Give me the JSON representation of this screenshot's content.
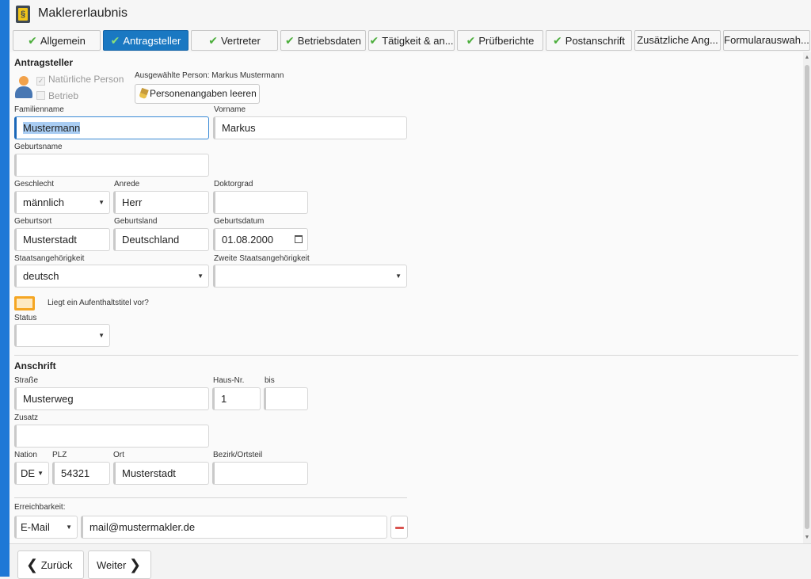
{
  "app": {
    "title": "Maklererlaubnis",
    "icon": "paragraph-book-icon"
  },
  "tabs": [
    {
      "label": "Allgemein",
      "done": true
    },
    {
      "label": "Antragsteller",
      "done": true,
      "active": true
    },
    {
      "label": "Vertreter",
      "done": true
    },
    {
      "label": "Betriebsdaten",
      "done": true
    },
    {
      "label": "Tätigkeit & an...",
      "done": true
    },
    {
      "label": "Prüfberichte",
      "done": true
    },
    {
      "label": "Postanschrift",
      "done": true
    },
    {
      "label": "Zusätzliche Ang...",
      "done": false
    },
    {
      "label": "Formularauswah...",
      "done": false
    }
  ],
  "applicant": {
    "section_title": "Antragsteller",
    "type_natural": "Natürliche Person",
    "type_business": "Betrieb",
    "selected_person": "Ausgewählte Person: Markus Mustermann",
    "clear_button": "Personenangaben leeren",
    "surname": {
      "label": "Familienname",
      "value": "Mustermann"
    },
    "firstname": {
      "label": "Vorname",
      "value": "Markus"
    },
    "birthname": {
      "label": "Geburtsname",
      "value": ""
    },
    "gender": {
      "label": "Geschlecht",
      "value": "männlich"
    },
    "salutation": {
      "label": "Anrede",
      "value": "Herr"
    },
    "doctorate": {
      "label": "Doktorgrad",
      "value": ""
    },
    "birthplace": {
      "label": "Geburtsort",
      "value": "Musterstadt"
    },
    "birthcountry": {
      "label": "Geburtsland",
      "value": "Deutschland"
    },
    "birthdate": {
      "label": "Geburtsdatum",
      "value": "01.08.2000"
    },
    "citizenship": {
      "label": "Staatsangehörigkeit",
      "value": "deutsch"
    },
    "second_citizenship": {
      "label": "Zweite Staatsangehörigkeit",
      "value": ""
    },
    "residence_question": "Liegt ein Aufenthaltstitel vor?",
    "status": {
      "label": "Status",
      "value": ""
    }
  },
  "address": {
    "section_title": "Anschrift",
    "street": {
      "label": "Straße",
      "value": "Musterweg"
    },
    "house_no": {
      "label": "Haus-Nr.",
      "value": "1"
    },
    "house_to": {
      "label": "bis",
      "value": ""
    },
    "suffix": {
      "label": "Zusatz",
      "value": ""
    },
    "nation": {
      "label": "Nation",
      "value": "DE"
    },
    "zip": {
      "label": "PLZ",
      "value": "54321"
    },
    "city": {
      "label": "Ort",
      "value": "Musterstadt"
    },
    "district": {
      "label": "Bezirk/Ortsteil",
      "value": ""
    }
  },
  "contact": {
    "label": "Erreichbarkeit:",
    "type": "E-Mail",
    "value": "mail@mustermakler.de"
  },
  "footer": {
    "back": "Zurück",
    "next": "Weiter"
  }
}
